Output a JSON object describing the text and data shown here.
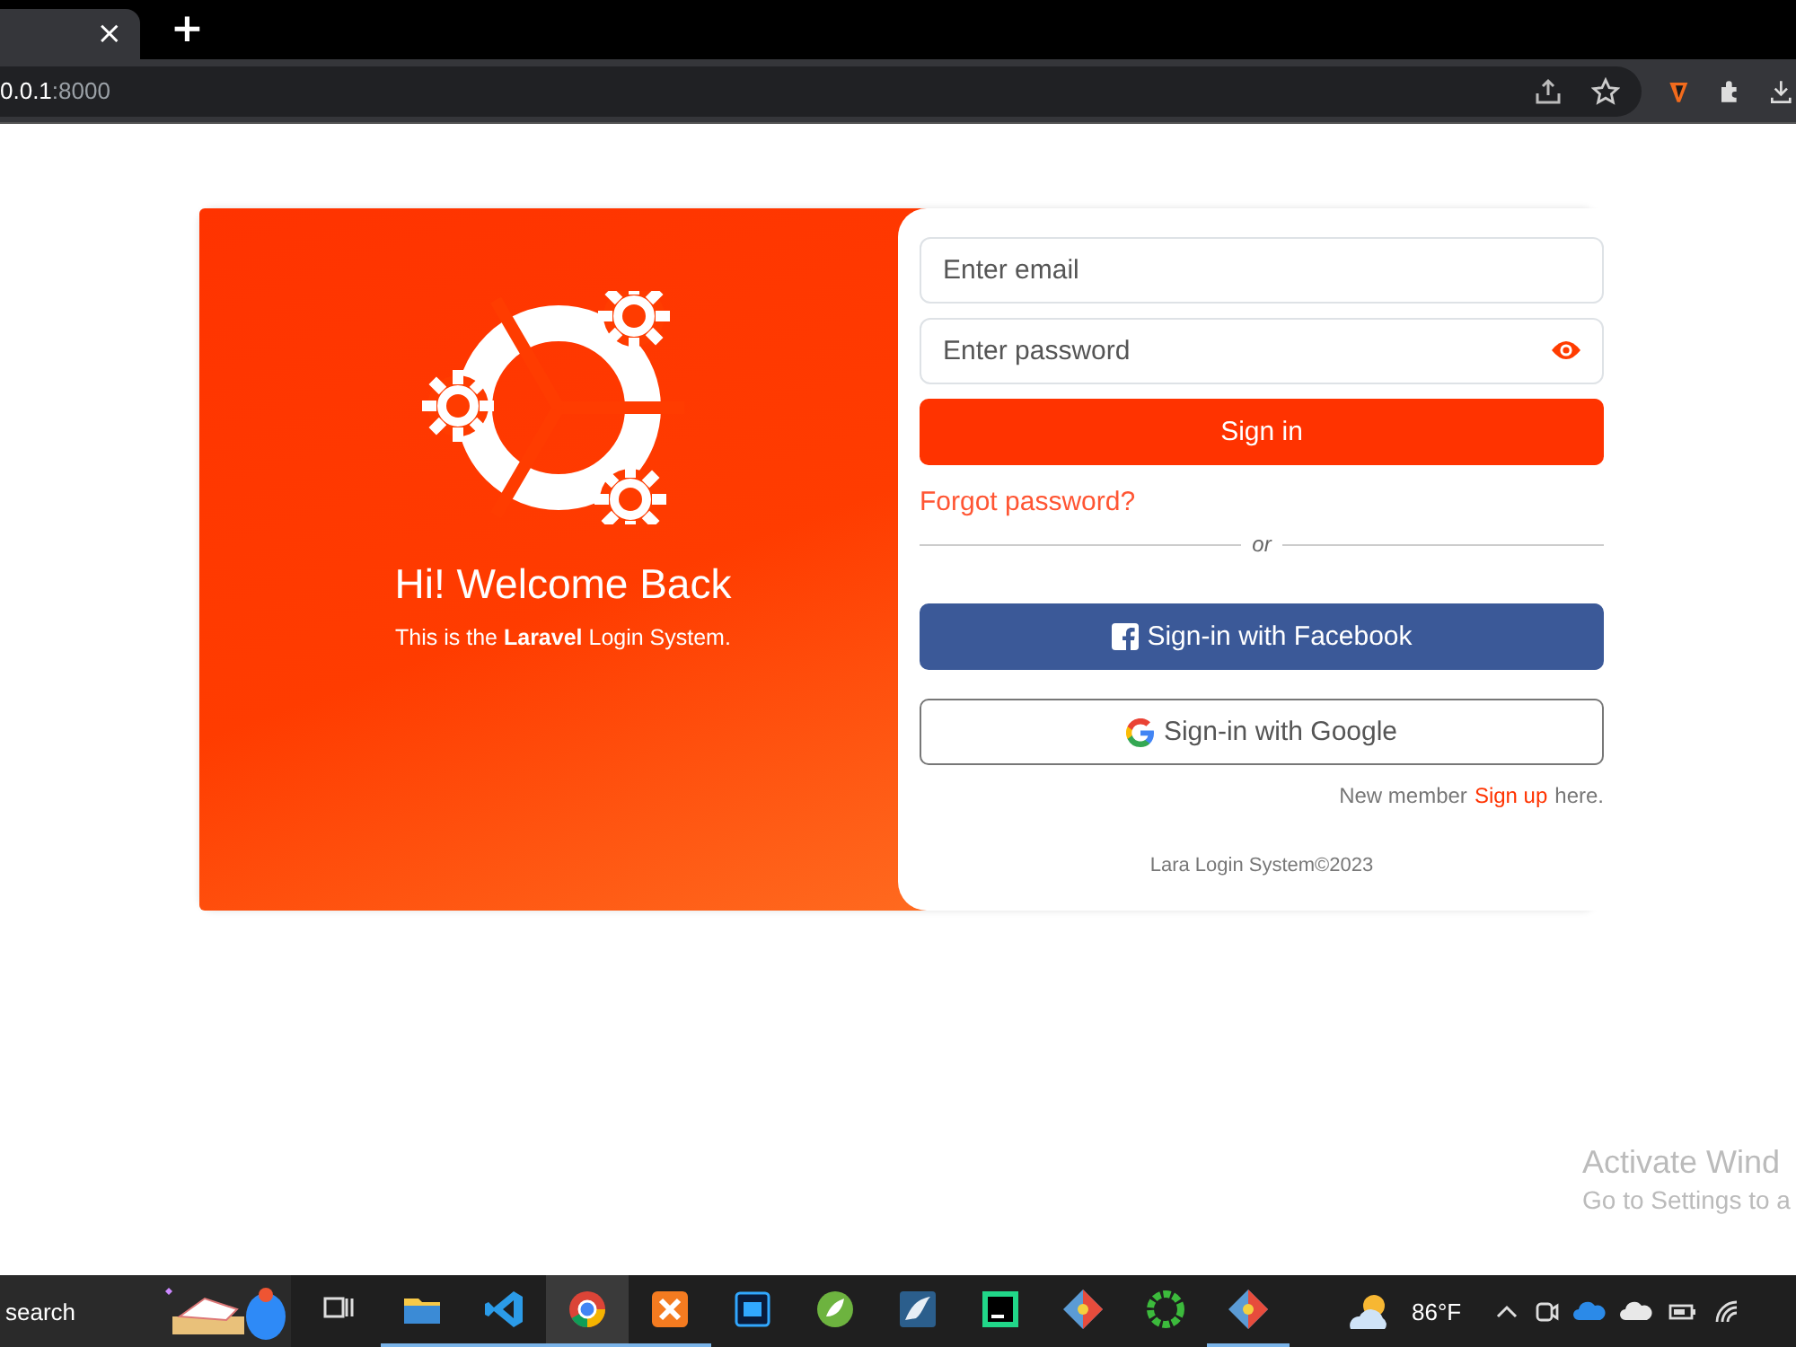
{
  "browser": {
    "tab_close": "×",
    "new_tab": "+",
    "address": {
      "host": "0.0.1",
      "port": ":8000"
    }
  },
  "login": {
    "welcome": {
      "title": "Hi! Welcome Back",
      "subtitle": "This is the **Laravel** Login System."
    },
    "email": {
      "placeholder": "Enter email"
    },
    "password": {
      "placeholder": "Enter password"
    },
    "sign_in": "Sign in",
    "forgot": "Forgot password?",
    "divider": "or",
    "social": [
      {
        "kind": "facebook",
        "label": "Sign-in with Facebook"
      },
      {
        "kind": "google",
        "label": "Sign-in with Google"
      }
    ],
    "signup": {
      "before": "New member",
      "link": "Sign up",
      "after": "here."
    },
    "footer": "Lara Login System©2023"
  },
  "watermark": {
    "title": "Activate Wind",
    "subtitle": "Go to Settings to a"
  },
  "taskbar": {
    "search": "search",
    "apps": [
      {
        "kind": "taskview",
        "running": false,
        "selected": false
      },
      {
        "kind": "folder",
        "running": true,
        "selected": false
      },
      {
        "kind": "vscode",
        "running": true,
        "selected": false
      },
      {
        "kind": "chrome",
        "running": true,
        "selected": true
      },
      {
        "kind": "xampp",
        "running": true,
        "selected": false
      },
      {
        "kind": "photoshop",
        "running": false,
        "selected": false
      },
      {
        "kind": "leaf",
        "running": false,
        "selected": false
      },
      {
        "kind": "dolphin",
        "running": false,
        "selected": false
      },
      {
        "kind": "pycharm",
        "running": false,
        "selected": false
      },
      {
        "kind": "diamond",
        "running": false,
        "selected": false
      },
      {
        "kind": "ring",
        "running": false,
        "selected": false
      },
      {
        "kind": "diamond",
        "running": true,
        "selected": false
      }
    ],
    "weather": "86°F"
  }
}
